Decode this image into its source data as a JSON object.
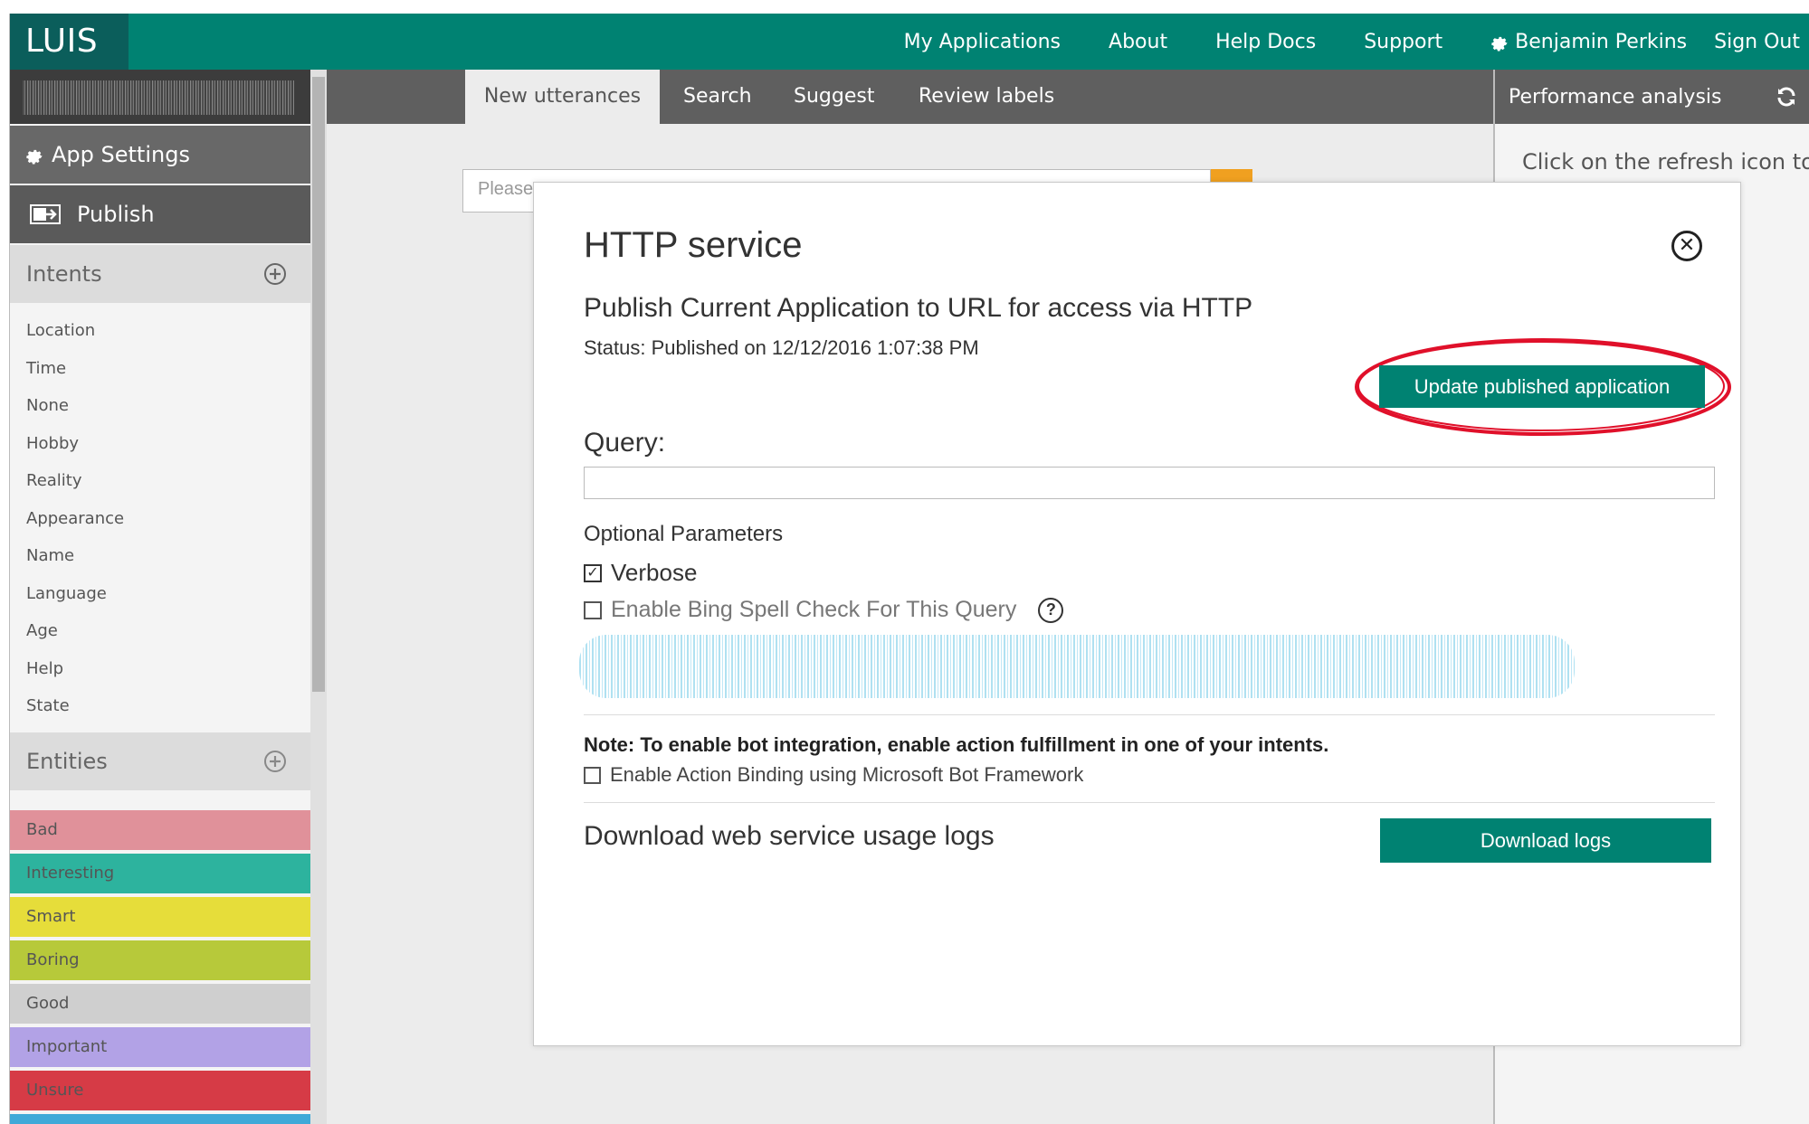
{
  "app": {
    "logo": "LUIS"
  },
  "topnav": {
    "my_applications": "My Applications",
    "about": "About",
    "help_docs": "Help Docs",
    "support": "Support",
    "user_name": "Benjamin Perkins",
    "sign_out": "Sign Out"
  },
  "sidebar": {
    "app_settings": "App Settings",
    "publish": "Publish",
    "intents_header": "Intents",
    "intents": [
      "Location",
      "Time",
      "None",
      "Hobby",
      "Reality",
      "Appearance",
      "Name",
      "Language",
      "Age",
      "Help",
      "State"
    ],
    "entities_header": "Entities",
    "entities": [
      {
        "label": "Bad",
        "color": "#e0919a"
      },
      {
        "label": "Interesting",
        "color": "#2db39e"
      },
      {
        "label": "Smart",
        "color": "#e6dd3a"
      },
      {
        "label": "Boring",
        "color": "#b7c93a"
      },
      {
        "label": "Good",
        "color": "#cfcfcf"
      },
      {
        "label": "Important",
        "color": "#b2a2e6"
      },
      {
        "label": "Unsure",
        "color": "#d63b46"
      }
    ]
  },
  "tabs": {
    "new_utterances": "New utterances",
    "search": "Search",
    "suggest": "Suggest",
    "review_labels": "Review labels"
  },
  "utterance": {
    "placeholder": "Please, enter an utterance"
  },
  "right_panel": {
    "title": "Performance analysis",
    "text": "Click on the refresh icon to"
  },
  "modal": {
    "title": "HTTP service",
    "subtitle": "Publish Current Application to URL for access via HTTP",
    "status": "Status: Published on 12/12/2016 1:07:38 PM",
    "update_button": "Update published application",
    "query_label": "Query:",
    "optional_params": "Optional Parameters",
    "verbose": "Verbose",
    "bing_spell": "Enable Bing Spell Check For This Query",
    "note": "Note: To enable bot integration, enable action fulfillment in one of your intents.",
    "action_binding": "Enable Action Binding using Microsoft Bot Framework",
    "download_label": "Download web service usage logs",
    "download_button": "Download logs"
  },
  "colors": {
    "brand_teal": "#008272",
    "logo_bg": "#0b5e5b",
    "highlight_red": "#e0102a"
  }
}
